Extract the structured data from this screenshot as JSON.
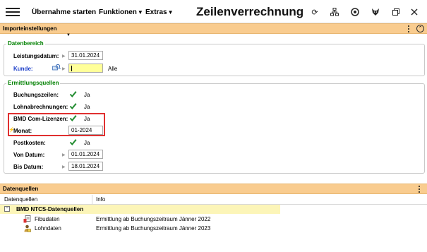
{
  "toolbar": {
    "menu_uebernahme": "Übernahme starten",
    "menu_funktionen": "Funktionen",
    "menu_extras": "Extras",
    "title": "Zeilenverrechnung",
    "icons": [
      "refresh-icon",
      "network-icon",
      "target-icon",
      "fox-icon",
      "restore-window-icon",
      "close-icon"
    ]
  },
  "import_panel": {
    "title": "Importeinstellungen",
    "collapse_glyph": "⌃"
  },
  "datenbereich": {
    "title": "Datenbereich",
    "leistungsdatum_label": "Leistungsdatum:",
    "leistungsdatum_value": "31.01.2024",
    "kunde_label": "Kunde:",
    "kunde_value": "",
    "kunde_suffix": "Alle"
  },
  "ermittlungsquellen": {
    "title": "Ermittlungsquellen",
    "rows": [
      {
        "label": "Buchungszeilen:",
        "checked": true,
        "text": "Ja"
      },
      {
        "label": "Lohnabrechnungen:",
        "checked": true,
        "text": "Ja"
      },
      {
        "label": "BMD Com-Lizenzen:",
        "checked": true,
        "text": "Ja"
      }
    ],
    "monat_label": "Monat:",
    "monat_value": "01-2024",
    "postkosten_label": "Postkosten:",
    "postkosten_text": "Ja",
    "von_datum_label": "Von Datum:",
    "von_datum_value": "01.01.2024",
    "bis_datum_label": "Bis Datum:",
    "bis_datum_value": "18.01.2024"
  },
  "datenquellen_panel": {
    "title": "Datenquellen",
    "columns": [
      "Datenquellen",
      "Info"
    ],
    "group": "BMD NTCS-Datenquellen",
    "rows": [
      {
        "name": "Fibudaten",
        "info": "Ermittlung ab Buchungszeitraum Jänner 2022",
        "icon": "accounting-icon"
      },
      {
        "name": "Lohndaten",
        "info": "Ermittlung ab Buchungszeitraum Jänner 2023",
        "icon": "payroll-icon"
      }
    ]
  },
  "colors": {
    "panel_header": "#f9cc8f",
    "group_title": "#008000",
    "highlight": "#e03030",
    "input_required": "#ffff99",
    "group_row": "#fcf5b8"
  }
}
